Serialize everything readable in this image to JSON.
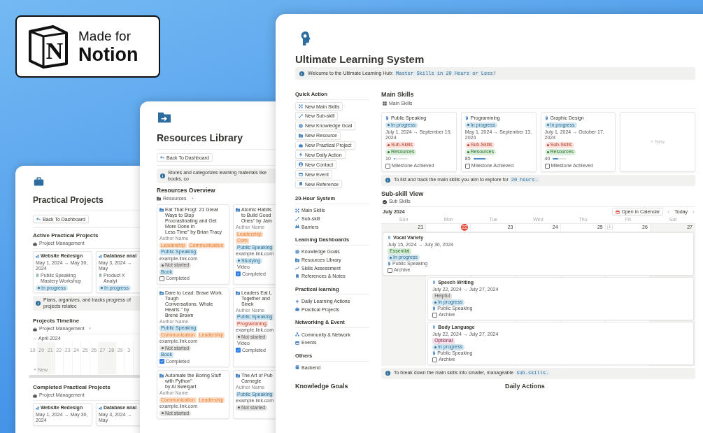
{
  "badge": {
    "logo_letter": "N",
    "line1": "Made for",
    "line2": "Notion"
  },
  "practical_window": {
    "title": "Practical Projects",
    "back_button": "Back To Dashboard",
    "active": {
      "heading": "Active Practical Projects",
      "view": "Project Management",
      "cards": [
        {
          "title": "Website Redesign",
          "dates": "May 1, 2024 → May 30, 2024",
          "relation": "Public Speaking Mastery Workshop",
          "status": {
            "text": "In progress",
            "color": "#d3e5ef"
          }
        },
        {
          "title": "Database anal",
          "dates": "May 3, 2024 → May",
          "relation": "Product X Analyt",
          "status": {
            "text": "In progress",
            "color": "#d3e5ef"
          }
        }
      ]
    },
    "callout": {
      "text": "Plans, organizes, and tracks progress of projects relatec"
    },
    "timeline": {
      "heading": "Projects Timeline",
      "view": "Project Management",
      "add": "+",
      "month": "April 2024",
      "new": "+ New",
      "days": [
        {
          "label": "19",
          "weekend": false
        },
        {
          "label": "20",
          "weekend": true
        },
        {
          "label": "21",
          "weekend": true
        },
        {
          "label": "22",
          "weekend": false
        },
        {
          "label": "23",
          "weekend": false
        },
        {
          "label": "24",
          "weekend": false
        },
        {
          "label": "25",
          "weekend": false
        },
        {
          "label": "26",
          "weekend": false
        },
        {
          "label": "27",
          "weekend": true
        },
        {
          "label": "28",
          "weekend": true
        },
        {
          "label": "29",
          "weekend": false
        },
        {
          "label": "3",
          "weekend": false
        }
      ]
    },
    "completed": {
      "heading": "Completed Practical Projects",
      "view": "Project Management",
      "cards": [
        {
          "title": "Website Redesign",
          "dates": "May 1, 2024 → May 30, 2024"
        },
        {
          "title": "Database anal",
          "dates": "May 3, 2024 → May"
        }
      ]
    }
  },
  "resources_window": {
    "title": "Resources Library",
    "back_button": "Back To Dashboard",
    "callout": {
      "text": "Stores and categorizes learning materials like books, co"
    },
    "heading": "Resources Overview",
    "view": "Resources",
    "add": "+",
    "cards": [
      {
        "title_lines": [
          "Eat That Frog!: 21 Great Ways to Stop",
          "Procrastinating and Get More Done in",
          "Less Time\" by Brian Tracy"
        ],
        "author": "Author Name",
        "tags": [
          {
            "text": "Leadership",
            "color": "#fadec9"
          },
          {
            "text": "Communication",
            "color": "#fadec9"
          },
          {
            "text": "Public Speaking",
            "color": "#d3e5ef"
          }
        ],
        "link": "example.link.com",
        "status": {
          "text": "Not started",
          "color": "#e3e2e0"
        },
        "type": {
          "text": "Book",
          "color": "#d3e5ef"
        },
        "completed": {
          "label": "Completed",
          "checked": false
        }
      },
      {
        "title_lines": [
          "Atomic Habits",
          "to Build Good",
          "Ones\" by Jam"
        ],
        "author": "Author Name",
        "tags": [
          {
            "text": "Leadership",
            "color": "#fadec9"
          },
          {
            "text": "Com",
            "color": "#fadec9"
          },
          {
            "text": "Public Speaking",
            "color": "#d3e5ef"
          }
        ],
        "link": "example.link.com",
        "status": {
          "text": "Studying",
          "color": "#d3e5ef"
        },
        "type": {
          "text": "Video",
          "color": "#ffffff"
        },
        "completed": {
          "label": "Completed",
          "checked": true
        }
      },
      {
        "title_lines": [
          "Dare to Lead: Brave Work. Tough",
          "Conversations. Whole Hearts.\" by",
          "Brené Brown"
        ],
        "author": "Author Name",
        "tags": [
          {
            "text": "Public Speaking",
            "color": "#d3e5ef"
          },
          {
            "text": "Communication",
            "color": "#fadec9"
          },
          {
            "text": "Leadership",
            "color": "#fadec9"
          }
        ],
        "link": "example.link.com",
        "status": {
          "text": "Not started",
          "color": "#e3e2e0"
        },
        "type": {
          "text": "Book",
          "color": "#d3e5ef"
        },
        "completed": {
          "label": "Completed",
          "checked": true
        }
      },
      {
        "title_lines": [
          "Leaders Eat L",
          "Together and",
          "Sinek"
        ],
        "author": "Author Name",
        "tags": [
          {
            "text": "Public Speaking",
            "color": "#d3e5ef"
          },
          {
            "text": "Programming",
            "color": "#ffe2dd"
          }
        ],
        "link": "example.link.com",
        "status": {
          "text": "Not started",
          "color": "#e3e2e0"
        },
        "type": {
          "text": "Video",
          "color": "#ffffff"
        },
        "completed": {
          "label": "Completed",
          "checked": true
        }
      },
      {
        "title_lines": [
          "Automate the Boring Stuff with Python\"",
          "by Al Sweigart"
        ],
        "author": "Author Name",
        "tags": [
          {
            "text": "Communication",
            "color": "#fadec9"
          },
          {
            "text": "Leadership",
            "color": "#fadec9"
          }
        ],
        "link": "example.link.com",
        "status": {
          "text": "Not started",
          "color": "#e3e2e0"
        }
      },
      {
        "title_lines": [
          "The Art of Pub",
          "Carnegie"
        ],
        "author": "Author Name",
        "tags": [
          {
            "text": "Public Speaking",
            "color": "#d3e5ef"
          }
        ],
        "link": "example.link.com",
        "status": {
          "text": "Not started",
          "color": "#e3e2e0"
        }
      }
    ]
  },
  "main_window": {
    "title": "Ultimate Learning System",
    "welcome": {
      "text": "Welcome to the Ultimate Learning Hub: ",
      "code": "Master Skills in 20 Hours or Less",
      "tail": "!"
    },
    "sidebar": [
      {
        "heading": "Quick Action",
        "kind": "buttons",
        "items": [
          "New Main Skills",
          "New Sub-skill",
          "New Knowledge Goal",
          "New Resource",
          "New Practical Project",
          "New Daily Action",
          "New Contact",
          "New Event",
          "New Reference"
        ]
      },
      {
        "heading": "20-Hour System",
        "kind": "links",
        "items": [
          "Main Skills",
          "Sub-skill",
          "Barriers"
        ]
      },
      {
        "heading": "Learning Dashboards",
        "kind": "links",
        "items": [
          "Knowledge Goals",
          "Resources Library",
          "Skills Assessment",
          "References & Notes"
        ]
      },
      {
        "heading": "Practical learning",
        "kind": "links",
        "items": [
          "Daily Learning Actions",
          "Practical Projects"
        ]
      },
      {
        "heading": "Networking & Event",
        "kind": "links",
        "items": [
          "Community & Network",
          "Events"
        ]
      },
      {
        "heading": "Others",
        "kind": "links",
        "items": [
          "Backend"
        ]
      }
    ],
    "main_skills": {
      "heading": "Main Skills",
      "view": "Main Skills",
      "new_card": "+ New",
      "cards": [
        {
          "title": "Public Speaking",
          "status": {
            "text": "In progress",
            "color": "#d3e5ef"
          },
          "dates": "July 1, 2024 → September 19, 2024",
          "sub_skills": {
            "text": "Sub-Skills",
            "color": "#ffe2dd"
          },
          "resources": {
            "text": "Resources",
            "color": "#dbeddb"
          },
          "progress": "10",
          "level": 0.1,
          "milestone": {
            "label": "Milestone Achieved",
            "checked": false
          }
        },
        {
          "title": "Programming",
          "status": {
            "text": "In progress",
            "color": "#d3e5ef"
          },
          "dates": "May 1, 2024 → September 13, 2024",
          "sub_skills": {
            "text": "Sub-Skills",
            "color": "#ffe2dd"
          },
          "resources": {
            "text": "Resources",
            "color": "#dbeddb"
          },
          "progress": "85",
          "level": 0.85,
          "milestone": {
            "label": "Milestone Achieved",
            "checked": false
          }
        },
        {
          "title": "Graphic Design",
          "status": {
            "text": "In progress",
            "color": "#d3e5ef"
          },
          "dates": "July 1, 2024 → October 17, 2024",
          "sub_skills": {
            "text": "Sub-Skills",
            "color": "#ffe2dd"
          },
          "resources": {
            "text": "Resources",
            "color": "#dbeddb"
          },
          "progress": "40",
          "level": 0.4,
          "milestone": {
            "label": "Milestone Achieved",
            "checked": false
          }
        }
      ]
    },
    "skills_callout": {
      "text": "To list and track the main skills you aim to explore for ",
      "code": "20 hours."
    },
    "subskills": {
      "heading": "Sub-skill View",
      "view": "Sub Skills",
      "month": "July 2024",
      "open_button": "Open in Calendar",
      "today_button": "Today",
      "weekdays": [
        "Sun",
        "Mon",
        "Tue",
        "Wed",
        "Thu",
        "Fri",
        "Sat"
      ],
      "days": [
        {
          "label": "21",
          "today": false,
          "weekend": true
        },
        {
          "label": "22",
          "today": true,
          "weekend": false
        },
        {
          "label": "23",
          "today": false,
          "weekend": false
        },
        {
          "label": "24",
          "today": false,
          "weekend": false
        },
        {
          "label": "25",
          "today": false,
          "weekend": false
        },
        {
          "label": "26",
          "today": false,
          "weekend": false,
          "add": "+"
        },
        {
          "label": "27",
          "today": false,
          "weekend": true
        }
      ],
      "events": [
        {
          "title": "Vocal Variety",
          "dates": "July 15, 2024 → July 30, 2024",
          "priority": {
            "text": "Essential",
            "color": "#dbeddb"
          },
          "status": {
            "text": "In progress",
            "color": "#d3e5ef"
          },
          "skill": "Public Speaking",
          "archive": {
            "label": "Archive",
            "checked": false
          }
        },
        {
          "title": "Speech Writing",
          "dates": "July 22, 2024 → July 27, 2024",
          "priority": {
            "text": "Helpful",
            "color": "#e3e2e0"
          },
          "status": {
            "text": "In progress",
            "color": "#d3e5ef"
          },
          "skill": "Public Speaking",
          "archive": {
            "label": "Archive",
            "checked": false
          }
        },
        {
          "title": "Body Language",
          "dates": "July 22, 2024 → July 27, 2024",
          "priority": {
            "text": "Optional",
            "color": "#f5e0e9"
          },
          "status": {
            "text": "In progress",
            "color": "#d3e5ef"
          },
          "skill": "Public Speaking",
          "archive": {
            "label": "Archive",
            "checked": false
          }
        }
      ]
    },
    "subskills_callout": {
      "text": "To break down the main skills into smaller, manageable ",
      "code": "sub-skills."
    },
    "bottom_headings": [
      "Knowledge Goals",
      "Daily Actions"
    ]
  }
}
